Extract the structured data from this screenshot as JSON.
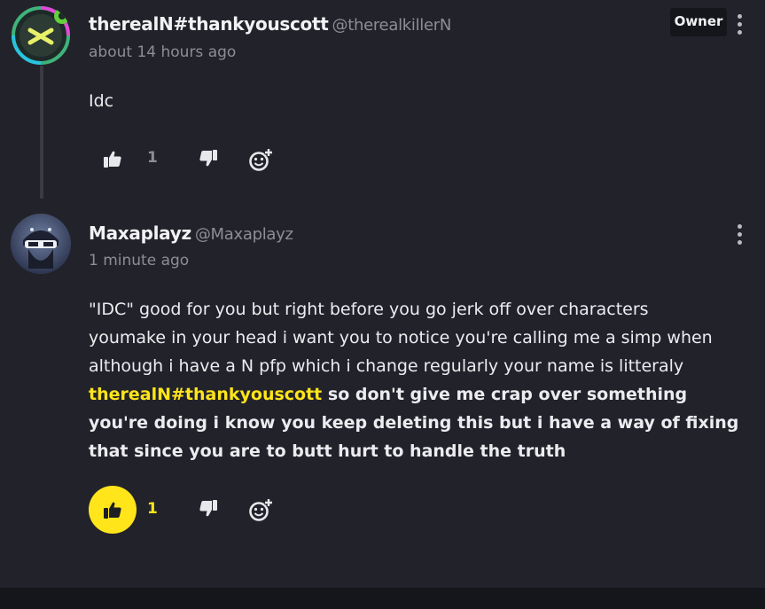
{
  "comments": [
    {
      "author": "therealN#thankyouscott",
      "handle": "@therealkillerN",
      "timestamp": "about 14 hours ago",
      "badge": "Owner",
      "body": "Idc",
      "likes": "1",
      "liked": false
    },
    {
      "author": "Maxaplayz",
      "handle": "@Maxaplayz",
      "timestamp": "1 minute ago",
      "body_lines": [
        "\"IDC\" good for you but right before you go jerk off over characters",
        "youmake in your head i want you to notice you're calling me a simp when",
        "although i have a N pfp which i change regularly your name is litteraly"
      ],
      "mention": "therealN#thankyouscott",
      "body_after_mention": " so don't give me crap over something you're doing i know you keep deleting this but i have a way of fixing that since you are to butt hurt to handle the truth",
      "likes": "1",
      "liked": true
    }
  ],
  "icons": {
    "like": "thumbs-up-icon",
    "dislike": "thumbs-down-icon",
    "react": "add-reaction-icon",
    "menu": "kebab-menu-icon"
  },
  "colors": {
    "background": "#22232a",
    "accent": "#ffe51a",
    "muted": "#8c8d96"
  }
}
